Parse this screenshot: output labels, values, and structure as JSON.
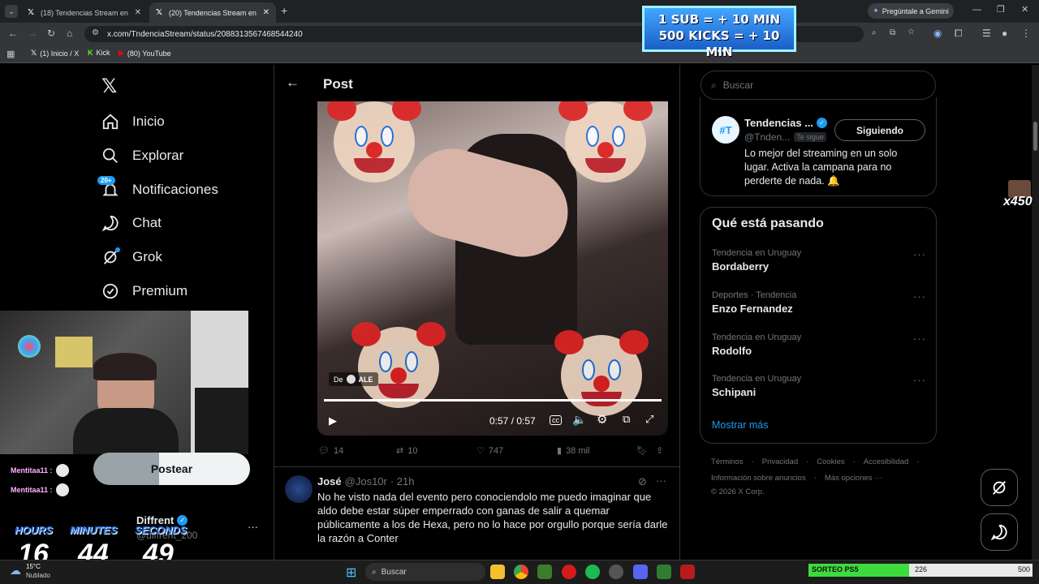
{
  "browser": {
    "tabs": [
      {
        "title": "(18) Tendencias Stream en X: \"..."
      },
      {
        "title": "(20) Tendencias Stream en X: \"..."
      }
    ],
    "new_tab": "+",
    "url": "x.com/TndenciaStream/status/2088313567468544240",
    "gemini_label": "Pregúntale a Gemini",
    "bookmarks": [
      "(1) Inicio / X",
      "Kick",
      "(80) YouTube"
    ]
  },
  "stream_banner": {
    "line1": "1 SUB = + 10 MIN",
    "line2": "500 KICKS = + 10 MIN"
  },
  "sidebar": {
    "items": [
      {
        "label": "Inicio",
        "icon": "home-icon"
      },
      {
        "label": "Explorar",
        "icon": "search-icon"
      },
      {
        "label": "Notificaciones",
        "icon": "bell-icon",
        "badge": "20+"
      },
      {
        "label": "Chat",
        "icon": "chat-icon"
      },
      {
        "label": "Grok",
        "icon": "grok-icon"
      },
      {
        "label": "Premium",
        "icon": "premium-icon"
      }
    ],
    "post_button": "Postear",
    "account": {
      "name": "Diffrent",
      "handle": "@diffrent_200"
    }
  },
  "post": {
    "header": "Post",
    "video": {
      "time": "0:57 / 0:57",
      "progress": 1.0,
      "caption_prefix": "De",
      "caption_name": "ALE"
    },
    "stats": {
      "replies": "14",
      "reposts": "10",
      "likes": "747",
      "views": "38 mil"
    },
    "reply": {
      "name": "José",
      "handle": "@Jos10r",
      "time": "· 21h",
      "text": "No he visto nada del evento pero conociendolo me puedo imaginar que aldo debe estar súper emperrado con ganas de salir a quemar públicamente a los de Hexa, pero no lo hace por orgullo porque sería darle la razón a Conter"
    }
  },
  "right": {
    "search_placeholder": "Buscar",
    "profile": {
      "name": "Tendencias ...",
      "handle": "@Tnden...",
      "follows_you": "Te sigue",
      "follow_button": "Siguiendo",
      "bio": "Lo mejor del streaming en un solo lugar. Activa la campana para no perderte de nada. 🔔"
    },
    "trends_title": "Qué está pasando",
    "trends": [
      {
        "context": "Tendencia en Uruguay",
        "name": "Bordaberry"
      },
      {
        "context": "Deportes · Tendencia",
        "name": "Enzo Fernandez"
      },
      {
        "context": "Tendencia en Uruguay",
        "name": "Rodolfo"
      },
      {
        "context": "Tendencia en Uruguay",
        "name": "Schipani"
      }
    ],
    "show_more": "Mostrar más",
    "footer": {
      "row1": [
        "Términos",
        "Privacidad",
        "Cookies",
        "Accesibilidad"
      ],
      "row2": [
        "Información sobre anuncios",
        "Más opciones ···"
      ],
      "copyright": "© 2026 X Corp."
    }
  },
  "overlay": {
    "chat": [
      {
        "user": "Mentitaa11 :"
      },
      {
        "user": "Mentitaa11 :"
      }
    ],
    "timer": {
      "hours_label": "HOURS",
      "minutes_label": "MINUTES",
      "seconds_label": "SECONDS",
      "hours": "16",
      "minutes": "44",
      "seconds": "49"
    },
    "multiplier": "x450"
  },
  "taskbar": {
    "weather_temp": "15°C",
    "weather_text": "Nublado",
    "search_label": "Buscar",
    "sorteo_label": "SORTEO PS5",
    "sorteo_current": "226",
    "sorteo_goal": "500",
    "sorteo_progress": 0.45
  },
  "colors": {
    "accent": "#1d9bf0",
    "background": "#000000",
    "border": "#2f3336",
    "muted": "#71767b"
  }
}
